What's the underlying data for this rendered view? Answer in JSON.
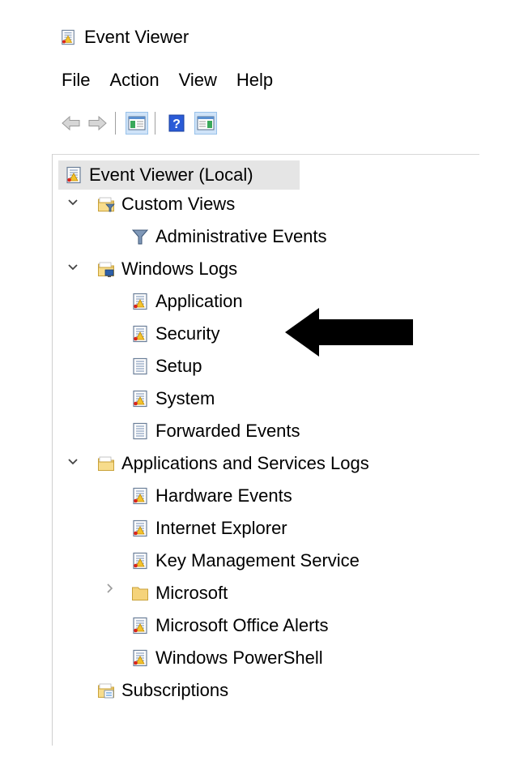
{
  "window": {
    "title": "Event Viewer"
  },
  "menu": {
    "items": [
      "File",
      "Action",
      "View",
      "Help"
    ]
  },
  "toolbar": {
    "buttons": [
      {
        "name": "back-button",
        "icon": "back-arrow-icon"
      },
      {
        "name": "forward-button",
        "icon": "forward-arrow-icon"
      },
      {
        "name": "show-hide-console-tree-button",
        "icon": "console-tree-icon"
      },
      {
        "name": "help-button",
        "icon": "help-icon"
      },
      {
        "name": "show-hide-action-pane-button",
        "icon": "action-pane-icon"
      }
    ]
  },
  "tree": {
    "root": {
      "label": "Event Viewer (Local)",
      "icon": "event-viewer-icon",
      "selected": true
    },
    "custom_views": {
      "label": "Custom Views",
      "icon": "folder-filter-icon",
      "expanded": true,
      "children": [
        {
          "label": "Administrative Events",
          "icon": "filter-icon"
        }
      ]
    },
    "windows_logs": {
      "label": "Windows Logs",
      "icon": "folder-computer-icon",
      "expanded": true,
      "children": [
        {
          "label": "Application",
          "icon": "event-log-icon"
        },
        {
          "label": "Security",
          "icon": "event-log-icon"
        },
        {
          "label": "Setup",
          "icon": "log-plain-icon"
        },
        {
          "label": "System",
          "icon": "event-log-icon"
        },
        {
          "label": "Forwarded Events",
          "icon": "log-plain-icon"
        }
      ]
    },
    "app_services_logs": {
      "label": "Applications and Services Logs",
      "icon": "folder-icon",
      "expanded": true,
      "children": [
        {
          "label": "Hardware Events",
          "icon": "event-log-icon"
        },
        {
          "label": "Internet Explorer",
          "icon": "event-log-icon"
        },
        {
          "label": "Key Management Service",
          "icon": "event-log-icon"
        },
        {
          "label": "Microsoft",
          "icon": "folder-icon",
          "expandable": true,
          "expanded": false
        },
        {
          "label": "Microsoft Office Alerts",
          "icon": "event-log-icon"
        },
        {
          "label": "Windows PowerShell",
          "icon": "event-log-icon"
        }
      ]
    },
    "subscriptions": {
      "label": "Subscriptions",
      "icon": "subscriptions-icon"
    }
  },
  "annotation": {
    "icon": "black-arrow-pointing-left-icon",
    "target": "Security"
  },
  "colors": {
    "selection": "#e5e5e5",
    "toolbar_active": "#cfe3f8",
    "folder": "#f5d37a",
    "arrow": "#000000"
  }
}
